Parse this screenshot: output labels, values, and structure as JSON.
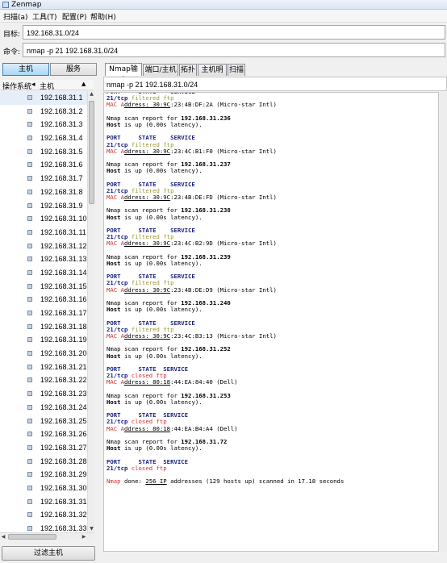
{
  "window": {
    "title": "Zenmap"
  },
  "menu": [
    {
      "label": "扫描(a)"
    },
    {
      "label": "工具(T)"
    },
    {
      "label": "配置(P)"
    },
    {
      "label": "帮助(H)"
    }
  ],
  "target": {
    "label": "目标:",
    "value": "192.168.31.0/24"
  },
  "command": {
    "label": "命令:",
    "value": "nmap -p 21 192.168.31.0/24"
  },
  "side_tabs": {
    "hosts": "主机",
    "services": "服务"
  },
  "host_header": {
    "os": "操作系统",
    "host": "主机"
  },
  "hosts": [
    "192.168.31.1",
    "192.168.31.2",
    "192.168.31.3",
    "192.168.31.4",
    "192.168.31.5",
    "192.168.31.6",
    "192.168.31.7",
    "192.168.31.8",
    "192.168.31.9",
    "192.168.31.10",
    "192.168.31.11",
    "192.168.31.12",
    "192.168.31.13",
    "192.168.31.14",
    "192.168.31.15",
    "192.168.31.16",
    "192.168.31.17",
    "192.168.31.18",
    "192.168.31.19",
    "192.168.31.20",
    "192.168.31.21",
    "192.168.31.22",
    "192.168.31.23",
    "192.168.31.24",
    "192.168.31.25",
    "192.168.31.26",
    "192.168.31.27",
    "192.168.31.28",
    "192.168.31.29",
    "192.168.31.30",
    "192.168.31.31",
    "192.168.31.32",
    "192.168.31.33"
  ],
  "filter_button": "过滤主机",
  "tabs": [
    "Nmap输出",
    "端口/主机",
    "拓扑",
    "主机明细",
    "扫描"
  ],
  "output_command": "nmap -p 21 192.168.31.0/24",
  "output_lines": [
    {
      "t": "PORT     STATE    SERVICE",
      "c": "c-hdr"
    },
    {
      "t": "21/tcp filtered ftp",
      "c": "port-filt"
    },
    {
      "t": "MAC Address: 30:9C:23:4B:DF:2A (Micro-star Intl)",
      "c": "mac"
    },
    {
      "t": "",
      "c": "blank"
    },
    {
      "t": "Nmap scan report for 192.168.31.236",
      "c": "report"
    },
    {
      "t": "Host is up (0.00s latency).",
      "c": "hostup"
    },
    {
      "t": "",
      "c": "blank"
    },
    {
      "t": "PORT     STATE    SERVICE",
      "c": "c-hdr"
    },
    {
      "t": "21/tcp filtered ftp",
      "c": "port-filt"
    },
    {
      "t": "MAC Address: 30:9C:23:4C:B1:F0 (Micro-star Intl)",
      "c": "mac"
    },
    {
      "t": "",
      "c": "blank"
    },
    {
      "t": "Nmap scan report for 192.168.31.237",
      "c": "report"
    },
    {
      "t": "Host is up (0.00s latency).",
      "c": "hostup"
    },
    {
      "t": "",
      "c": "blank"
    },
    {
      "t": "PORT     STATE    SERVICE",
      "c": "c-hdr"
    },
    {
      "t": "21/tcp filtered ftp",
      "c": "port-filt"
    },
    {
      "t": "MAC Address: 30:9C:23:4B:DE:FD (Micro-star Intl)",
      "c": "mac"
    },
    {
      "t": "",
      "c": "blank"
    },
    {
      "t": "Nmap scan report for 192.168.31.238",
      "c": "report"
    },
    {
      "t": "Host is up (0.00s latency).",
      "c": "hostup"
    },
    {
      "t": "",
      "c": "blank"
    },
    {
      "t": "PORT     STATE    SERVICE",
      "c": "c-hdr"
    },
    {
      "t": "21/tcp filtered ftp",
      "c": "port-filt"
    },
    {
      "t": "MAC Address: 30:9C:23:4C:B2:9D (Micro-star Intl)",
      "c": "mac"
    },
    {
      "t": "",
      "c": "blank"
    },
    {
      "t": "Nmap scan report for 192.168.31.239",
      "c": "report"
    },
    {
      "t": "Host is up (0.00s latency).",
      "c": "hostup"
    },
    {
      "t": "",
      "c": "blank"
    },
    {
      "t": "PORT     STATE    SERVICE",
      "c": "c-hdr"
    },
    {
      "t": "21/tcp filtered ftp",
      "c": "port-filt"
    },
    {
      "t": "MAC Address: 30:9C:23:4B:DE:D9 (Micro-star Intl)",
      "c": "mac"
    },
    {
      "t": "",
      "c": "blank"
    },
    {
      "t": "Nmap scan report for 192.168.31.240",
      "c": "report"
    },
    {
      "t": "Host is up (0.00s latency).",
      "c": "hostup"
    },
    {
      "t": "",
      "c": "blank"
    },
    {
      "t": "PORT     STATE    SERVICE",
      "c": "c-hdr"
    },
    {
      "t": "21/tcp filtered ftp",
      "c": "port-filt"
    },
    {
      "t": "MAC Address: 30:9C:23:4C:B3:13 (Micro-star Intl)",
      "c": "mac"
    },
    {
      "t": "",
      "c": "blank"
    },
    {
      "t": "Nmap scan report for 192.168.31.252",
      "c": "report"
    },
    {
      "t": "Host is up (0.00s latency).",
      "c": "hostup"
    },
    {
      "t": "",
      "c": "blank"
    },
    {
      "t": "PORT     STATE  SERVICE",
      "c": "c-hdr"
    },
    {
      "t": "21/tcp closed ftp",
      "c": "port-closed"
    },
    {
      "t": "MAC Address: 80:18:44:EA:84:40 (Dell)",
      "c": "mac"
    },
    {
      "t": "",
      "c": "blank"
    },
    {
      "t": "Nmap scan report for 192.168.31.253",
      "c": "report"
    },
    {
      "t": "Host is up (0.00s latency).",
      "c": "hostup"
    },
    {
      "t": "",
      "c": "blank"
    },
    {
      "t": "PORT     STATE  SERVICE",
      "c": "c-hdr"
    },
    {
      "t": "21/tcp closed ftp",
      "c": "port-closed"
    },
    {
      "t": "MAC Address: 80:18:44:EA:B4:A4 (Dell)",
      "c": "mac"
    },
    {
      "t": "",
      "c": "blank"
    },
    {
      "t": "Nmap scan report for 192.168.31.72",
      "c": "report"
    },
    {
      "t": "Host is up (0.00s latency).",
      "c": "hostup"
    },
    {
      "t": "",
      "c": "blank"
    },
    {
      "t": "PORT     STATE  SERVICE",
      "c": "c-hdr"
    },
    {
      "t": "21/tcp closed ftp",
      "c": "port-closed"
    },
    {
      "t": "",
      "c": "blank"
    },
    {
      "t": "Nmap done: 256 IP addresses (129 hosts up) scanned in 17.18 seconds",
      "c": "done"
    }
  ],
  "colors": {
    "header": "#1a237e",
    "filtered": "#9a9a3a",
    "closed": "#d32f2f",
    "mac": "#d32f2f"
  }
}
